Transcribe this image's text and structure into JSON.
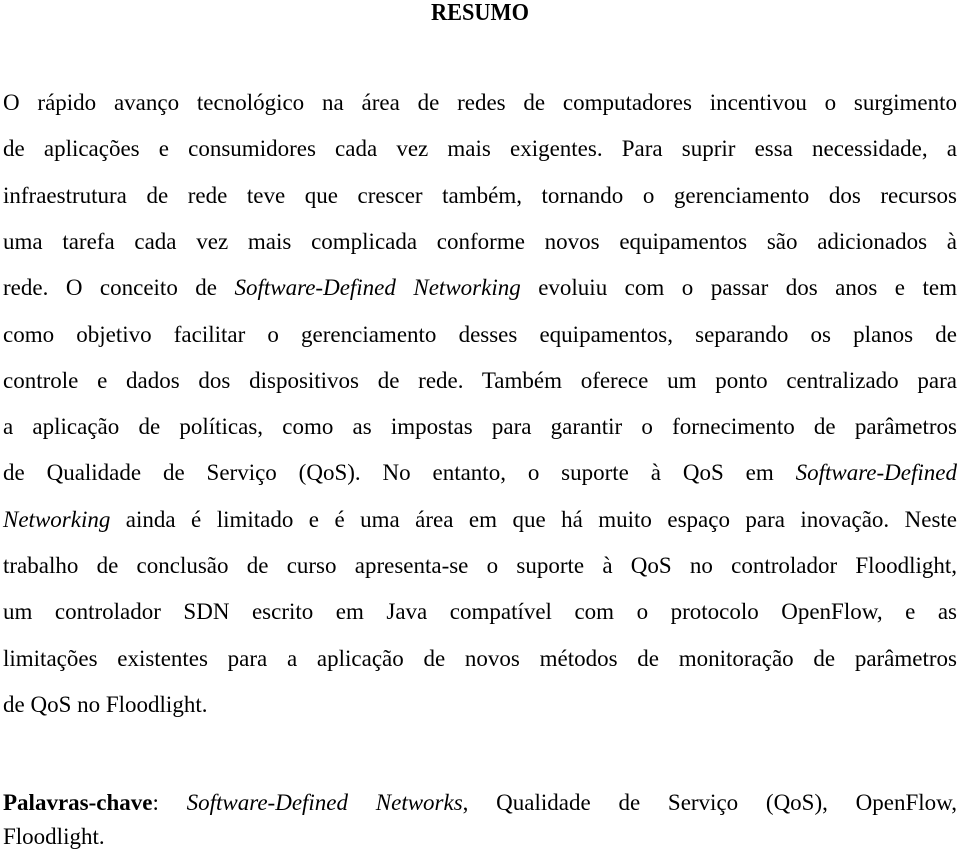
{
  "title": "RESUMO",
  "abstract": {
    "lines": [
      [
        {
          "t": "O rápido avanço tecnológico na área de redes de computadores incentivou o surgimento"
        }
      ],
      [
        {
          "t": "de aplicações e consumidores cada vez mais exigentes. Para suprir essa necessidade, a"
        }
      ],
      [
        {
          "t": "infraestrutura de rede teve que crescer também, tornando o gerenciamento dos recursos"
        }
      ],
      [
        {
          "t": "uma tarefa cada vez mais complicada conforme novos equipamentos são adicionados à"
        }
      ],
      [
        {
          "t": "rede. O conceito de "
        },
        {
          "t": "Software-Defined Networking",
          "i": true
        },
        {
          "t": " evoluiu com o passar dos anos e tem"
        }
      ],
      [
        {
          "t": "como objetivo facilitar o gerenciamento desses equipamentos, separando os planos de"
        }
      ],
      [
        {
          "t": "controle e dados dos dispositivos de rede.  Também oferece um ponto centralizado para"
        }
      ],
      [
        {
          "t": "a aplicação de políticas, como as impostas para garantir o fornecimento de parâmetros"
        }
      ],
      [
        {
          "t": "de Qualidade de Serviço (QoS). No entanto, o suporte à QoS em "
        },
        {
          "t": "Software-Defined",
          "i": true
        }
      ],
      [
        {
          "t": "Networking",
          "i": true
        },
        {
          "t": " ainda é limitado e é uma área em que há muito espaço para inovação. Neste"
        }
      ],
      [
        {
          "t": "trabalho de conclusão de curso apresenta-se o suporte à QoS no controlador Floodlight,"
        }
      ],
      [
        {
          "t": "um controlador SDN escrito em Java compatível com o protocolo OpenFlow, e as"
        }
      ],
      [
        {
          "t": "limitações existentes para a aplicação de novos métodos de monitoração de parâmetros"
        }
      ],
      [
        {
          "t": "de QoS no Floodlight."
        }
      ]
    ]
  },
  "keywords": {
    "lines": [
      [
        {
          "t": "Palavras-chave",
          "b": true
        },
        {
          "t": ": "
        },
        {
          "t": "Software-Defined Networks",
          "i": true
        },
        {
          "t": ", Qualidade de Serviço (QoS), OpenFlow,"
        }
      ],
      [
        {
          "t": "Floodlight."
        }
      ]
    ]
  }
}
